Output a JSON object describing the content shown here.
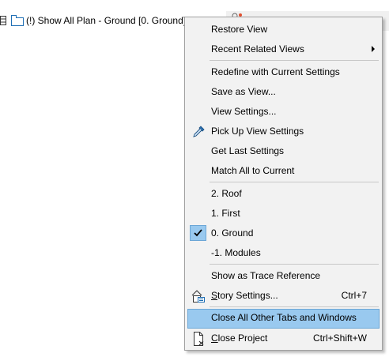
{
  "tab": {
    "title": "(!) Show All Plan - Ground [0. Ground]"
  },
  "menu": {
    "items": [
      {
        "label": "Restore View"
      },
      {
        "label": "Recent Related Views",
        "submenu": true
      },
      {
        "label": "Redefine with Current Settings"
      },
      {
        "label": "Save as View..."
      },
      {
        "label": "View Settings..."
      },
      {
        "label": "Pick Up View Settings",
        "icon": "eyedropper-icon"
      },
      {
        "label": "Get Last Settings"
      },
      {
        "label": "Match All to Current"
      },
      {
        "label": "2. Roof"
      },
      {
        "label": "1. First"
      },
      {
        "label": "0. Ground",
        "checked": true
      },
      {
        "label": "-1. Modules"
      },
      {
        "label": "Show as Trace Reference"
      },
      {
        "label_underlined": "S",
        "label_rest": "tory Settings...",
        "shortcut": "Ctrl+7",
        "icon": "story-settings-icon"
      },
      {
        "label": "Close All Other Tabs and Windows",
        "highlighted": true
      },
      {
        "label_underlined": "C",
        "label_rest": "lose Project",
        "shortcut": "Ctrl+Shift+W",
        "icon": "close-project-icon"
      }
    ]
  },
  "colors": {
    "highlight": "#99c9ef",
    "highlight_border": "#6ba6d6",
    "menu_bg": "#f2f2f2"
  }
}
